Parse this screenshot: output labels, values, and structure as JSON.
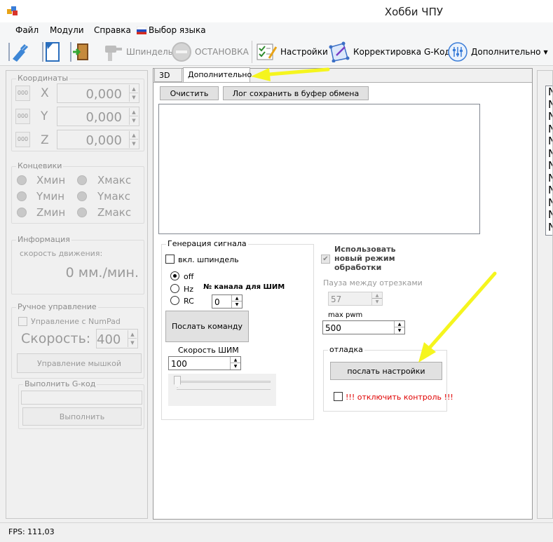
{
  "window": {
    "title": "Хобби ЧПУ"
  },
  "menu": {
    "file": "Файл",
    "modules": "Модули",
    "help": "Справка",
    "language": "Выбор языка"
  },
  "toolbar": {
    "spindle": "Шпиндель",
    "stop": "ОСТАНОВКА",
    "settings": "Настройки",
    "gcode_correction": "Корректировка G-Кода",
    "additional": "Дополнительно"
  },
  "coords": {
    "title": "Координаты",
    "rows": [
      {
        "btn": "000",
        "axis": "X",
        "value": "0,000"
      },
      {
        "btn": "000",
        "axis": "Y",
        "value": "0,000"
      },
      {
        "btn": "000",
        "axis": "Z",
        "value": "0,000"
      }
    ]
  },
  "limits": {
    "title": "Концевики",
    "xmin": "Xмин",
    "xmax": "Xмакс",
    "ymin": "Yмин",
    "ymax": "Yмакс",
    "zmin": "Zмин",
    "zmax": "Zмакс"
  },
  "info": {
    "title": "Информация",
    "speed_label": "скорость движения:",
    "speed_value": "0 мм./мин."
  },
  "manual": {
    "title": "Ручное управление",
    "numpad": "Управление с NumPad",
    "speed_label": "Скорость:",
    "speed_value": "400",
    "mouse_btn": "Управление мышкой"
  },
  "gcode": {
    "title": "Выполнить G-код",
    "input": "",
    "run_btn": "Выполнить"
  },
  "tabs": [
    {
      "label": "3D"
    },
    {
      "label": "Дополнительно"
    }
  ],
  "log": {
    "clear_btn": "Очистить",
    "copy_btn": "Лог сохранить в буфер обмена"
  },
  "signal": {
    "title": "Генерация сигнала",
    "spindle_on": "вкл. шпиндель",
    "off": "off",
    "hz": "Hz",
    "rc": "RC",
    "channel_label": "№ канала для ШИМ",
    "channel_value": "0",
    "send_btn": "Послать команду",
    "pwm_label": "Скорость ШИМ",
    "pwm_value": "100",
    "pwm_slider": 0
  },
  "mode": {
    "new_mode": "Использовать новый режим обработки",
    "pause_label": "Пауза между отрезками",
    "pause_value": "57",
    "maxpwm_label": "max pwm",
    "maxpwm_value": "500"
  },
  "debug": {
    "title": "отладка",
    "send_settings_btn": "послать настройки",
    "disable_control": "!!! отключить контроль !!!"
  },
  "right_list": [
    "N",
    "N",
    "N",
    "N",
    "N",
    "N",
    "N",
    "N",
    "N",
    "N",
    "N",
    "N"
  ],
  "status": {
    "fps": "FPS: 111,03"
  },
  "colors": {
    "arrow": "#f5f51e",
    "warning_text": "#e00000"
  }
}
